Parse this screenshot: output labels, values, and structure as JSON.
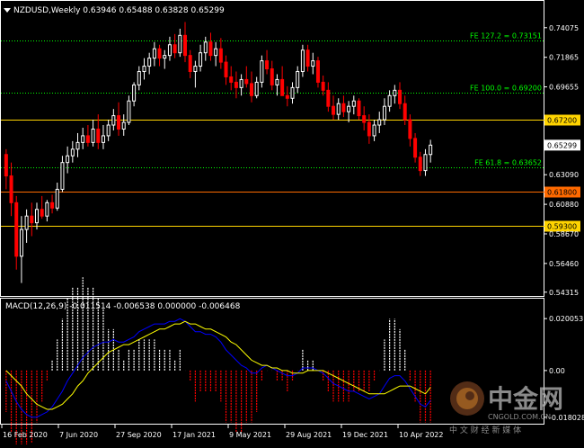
{
  "window": {
    "symbol": "NZDUSD",
    "timeframe": "Weekly",
    "header_text": "NZDUSD,Weekly  0.63946 0.65488 0.63828 0.65299"
  },
  "colors": {
    "background": "#000000",
    "grid": "#ffffff",
    "bull_candle": "#ffffff",
    "bear_candle": "#ff0000",
    "fib_line": "#00ff00",
    "hline_upper": "#ffd400",
    "hline_mid": "#ff6a00",
    "hline_lower": "#ffd400",
    "price_tag_hline": "#ffcc00",
    "macd_main": "#0000ff",
    "macd_signal": "#ffff00",
    "hist_up": "#ffffff",
    "hist_down": "#ff0000"
  },
  "price_axis": {
    "labels": [
      "0.74075",
      "0.71865",
      "0.69655",
      "0.65299",
      "0.63090",
      "0.60880",
      "0.58670",
      "0.56460",
      "0.54315"
    ]
  },
  "horizontal_lines": [
    {
      "label": "0.67200",
      "price": 0.672,
      "color_key": "hline_upper"
    },
    {
      "label": "0.61800",
      "price": 0.618,
      "color_key": "hline_mid"
    },
    {
      "label": "0.59300",
      "price": 0.593,
      "color_key": "hline_lower"
    }
  ],
  "fib_lines": [
    {
      "label": "FE 127.2 = 0.73151",
      "price": 0.73151
    },
    {
      "label": "FE 100.0 = 0.69200",
      "price": 0.692
    },
    {
      "label": "FE 61.8 = 0.63652",
      "price": 0.63652
    }
  ],
  "current_price": {
    "label": "0.65299",
    "value": 0.65299
  },
  "macd": {
    "header": "MACD(12,26,9) -0.011514 -0.006538 0.000000 -0.006468",
    "axis_labels": [
      "0.020053",
      "0.00",
      "-0.018028"
    ]
  },
  "time_axis": {
    "labels": [
      "16 Feb 2020",
      "7 Jun 2020",
      "27 Sep 2020",
      "17 Jan 2021",
      "9 May 2021",
      "29 Aug 2021",
      "19 Dec 2021",
      "10 Apr 2022"
    ]
  },
  "watermark": {
    "logo_text": "中金网",
    "url": "CNGOLD.COM.CN",
    "tagline": "中 文 财 经 新 媒 体"
  },
  "chart_data": [
    {
      "type": "candlestick",
      "title": "NZDUSD,Weekly",
      "ylim": [
        0.543,
        0.748
      ],
      "values": [
        [
          0.646,
          0.65,
          0.62,
          0.63
        ],
        [
          0.63,
          0.64,
          0.6,
          0.61
        ],
        [
          0.61,
          0.615,
          0.56,
          0.57
        ],
        [
          0.57,
          0.6,
          0.55,
          0.59
        ],
        [
          0.59,
          0.605,
          0.58,
          0.6
        ],
        [
          0.6,
          0.61,
          0.585,
          0.595
        ],
        [
          0.595,
          0.61,
          0.59,
          0.605
        ],
        [
          0.605,
          0.615,
          0.598,
          0.6
        ],
        [
          0.6,
          0.612,
          0.596,
          0.61
        ],
        [
          0.61,
          0.616,
          0.602,
          0.606
        ],
        [
          0.606,
          0.625,
          0.604,
          0.62
        ],
        [
          0.62,
          0.645,
          0.618,
          0.64
        ],
        [
          0.64,
          0.652,
          0.632,
          0.645
        ],
        [
          0.645,
          0.656,
          0.64,
          0.65
        ],
        [
          0.65,
          0.662,
          0.644,
          0.655
        ],
        [
          0.655,
          0.666,
          0.65,
          0.66
        ],
        [
          0.66,
          0.668,
          0.652,
          0.655
        ],
        [
          0.655,
          0.672,
          0.652,
          0.665
        ],
        [
          0.665,
          0.676,
          0.65,
          0.655
        ],
        [
          0.655,
          0.668,
          0.65,
          0.66
        ],
        [
          0.66,
          0.672,
          0.656,
          0.668
        ],
        [
          0.668,
          0.68,
          0.664,
          0.675
        ],
        [
          0.675,
          0.685,
          0.66,
          0.665
        ],
        [
          0.665,
          0.676,
          0.66,
          0.67
        ],
        [
          0.67,
          0.69,
          0.668,
          0.686
        ],
        [
          0.686,
          0.7,
          0.682,
          0.698
        ],
        [
          0.698,
          0.712,
          0.694,
          0.708
        ],
        [
          0.708,
          0.718,
          0.702,
          0.712
        ],
        [
          0.712,
          0.722,
          0.706,
          0.718
        ],
        [
          0.718,
          0.73,
          0.712,
          0.725
        ],
        [
          0.725,
          0.728,
          0.712,
          0.718
        ],
        [
          0.718,
          0.724,
          0.71,
          0.72
        ],
        [
          0.72,
          0.734,
          0.716,
          0.728
        ],
        [
          0.728,
          0.736,
          0.718,
          0.722
        ],
        [
          0.722,
          0.74,
          0.719,
          0.735
        ],
        [
          0.735,
          0.745,
          0.715,
          0.72
        ],
        [
          0.72,
          0.724,
          0.703,
          0.708
        ],
        [
          0.708,
          0.716,
          0.696,
          0.712
        ],
        [
          0.712,
          0.728,
          0.708,
          0.722
        ],
        [
          0.722,
          0.734,
          0.716,
          0.73
        ],
        [
          0.73,
          0.737,
          0.716,
          0.72
        ],
        [
          0.72,
          0.73,
          0.712,
          0.725
        ],
        [
          0.725,
          0.733,
          0.71,
          0.715
        ],
        [
          0.715,
          0.72,
          0.698,
          0.704
        ],
        [
          0.704,
          0.712,
          0.694,
          0.7
        ],
        [
          0.7,
          0.708,
          0.688,
          0.696
        ],
        [
          0.696,
          0.706,
          0.69,
          0.702
        ],
        [
          0.702,
          0.712,
          0.696,
          0.699
        ],
        [
          0.699,
          0.708,
          0.685,
          0.69
        ],
        [
          0.69,
          0.704,
          0.688,
          0.7
        ],
        [
          0.7,
          0.72,
          0.696,
          0.716
        ],
        [
          0.716,
          0.724,
          0.706,
          0.71
        ],
        [
          0.71,
          0.716,
          0.694,
          0.698
        ],
        [
          0.698,
          0.706,
          0.69,
          0.702
        ],
        [
          0.702,
          0.712,
          0.696,
          0.69
        ],
        [
          0.69,
          0.697,
          0.682,
          0.688
        ],
        [
          0.688,
          0.7,
          0.684,
          0.696
        ],
        [
          0.696,
          0.712,
          0.692,
          0.708
        ],
        [
          0.708,
          0.728,
          0.704,
          0.724
        ],
        [
          0.724,
          0.728,
          0.708,
          0.712
        ],
        [
          0.712,
          0.722,
          0.706,
          0.716
        ],
        [
          0.716,
          0.719,
          0.696,
          0.7
        ],
        [
          0.7,
          0.705,
          0.69,
          0.694
        ],
        [
          0.694,
          0.7,
          0.678,
          0.682
        ],
        [
          0.682,
          0.69,
          0.672,
          0.676
        ],
        [
          0.676,
          0.688,
          0.672,
          0.684
        ],
        [
          0.684,
          0.69,
          0.674,
          0.678
        ],
        [
          0.678,
          0.686,
          0.67,
          0.682
        ],
        [
          0.682,
          0.69,
          0.676,
          0.686
        ],
        [
          0.686,
          0.688,
          0.672,
          0.675
        ],
        [
          0.675,
          0.682,
          0.664,
          0.67
        ],
        [
          0.67,
          0.676,
          0.654,
          0.66
        ],
        [
          0.66,
          0.672,
          0.656,
          0.668
        ],
        [
          0.668,
          0.678,
          0.662,
          0.672
        ],
        [
          0.672,
          0.688,
          0.668,
          0.682
        ],
        [
          0.682,
          0.694,
          0.678,
          0.69
        ],
        [
          0.69,
          0.698,
          0.684,
          0.694
        ],
        [
          0.694,
          0.7,
          0.68,
          0.684
        ],
        [
          0.684,
          0.69,
          0.668,
          0.672
        ],
        [
          0.672,
          0.676,
          0.652,
          0.658
        ],
        [
          0.658,
          0.662,
          0.64,
          0.644
        ],
        [
          0.644,
          0.648,
          0.63,
          0.634
        ],
        [
          0.634,
          0.65,
          0.63,
          0.646
        ],
        [
          0.646,
          0.657,
          0.64,
          0.653
        ]
      ]
    },
    {
      "type": "bar+line",
      "title": "MACD(12,26,9)",
      "ylim": [
        -0.0195,
        0.0215
      ],
      "series": [
        {
          "name": "MACD",
          "values": [
            -0.004,
            -0.008,
            -0.012,
            -0.015,
            -0.017,
            -0.018,
            -0.018,
            -0.017,
            -0.016,
            -0.014,
            -0.011,
            -0.008,
            -0.004,
            -0.001,
            0.002,
            0.005,
            0.007,
            0.009,
            0.01,
            0.011,
            0.011,
            0.012,
            0.011,
            0.011,
            0.012,
            0.013,
            0.015,
            0.016,
            0.017,
            0.018,
            0.018,
            0.018,
            0.019,
            0.019,
            0.02,
            0.019,
            0.017,
            0.015,
            0.015,
            0.014,
            0.014,
            0.013,
            0.011,
            0.008,
            0.006,
            0.004,
            0.002,
            0.001,
            -0.001,
            -0.001,
            0.001,
            0.002,
            0.001,
            0.0,
            -0.001,
            -0.002,
            -0.002,
            -0.001,
            0.001,
            0.001,
            0.001,
            0.0,
            -0.001,
            -0.003,
            -0.005,
            -0.006,
            -0.007,
            -0.008,
            -0.008,
            -0.009,
            -0.01,
            -0.011,
            -0.01,
            -0.009,
            -0.006,
            -0.003,
            -0.002,
            -0.002,
            -0.004,
            -0.007,
            -0.01,
            -0.013,
            -0.014,
            -0.0115
          ]
        },
        {
          "name": "Signal",
          "values": [
            0.0,
            -0.002,
            -0.004,
            -0.006,
            -0.009,
            -0.011,
            -0.013,
            -0.014,
            -0.015,
            -0.015,
            -0.014,
            -0.013,
            -0.011,
            -0.009,
            -0.006,
            -0.004,
            -0.001,
            0.001,
            0.003,
            0.005,
            0.007,
            0.008,
            0.009,
            0.01,
            0.01,
            0.011,
            0.012,
            0.013,
            0.014,
            0.015,
            0.016,
            0.016,
            0.017,
            0.018,
            0.018,
            0.019,
            0.018,
            0.018,
            0.017,
            0.016,
            0.016,
            0.015,
            0.014,
            0.013,
            0.011,
            0.01,
            0.008,
            0.006,
            0.004,
            0.003,
            0.002,
            0.002,
            0.001,
            0.001,
            0.0,
            0.0,
            -0.001,
            -0.001,
            -0.001,
            0.0,
            0.0,
            0.0,
            0.0,
            -0.001,
            -0.002,
            -0.003,
            -0.004,
            -0.005,
            -0.006,
            -0.007,
            -0.008,
            -0.009,
            -0.009,
            -0.009,
            -0.009,
            -0.008,
            -0.007,
            -0.006,
            -0.006,
            -0.006,
            -0.007,
            -0.008,
            -0.009,
            -0.0065
          ]
        }
      ]
    }
  ]
}
